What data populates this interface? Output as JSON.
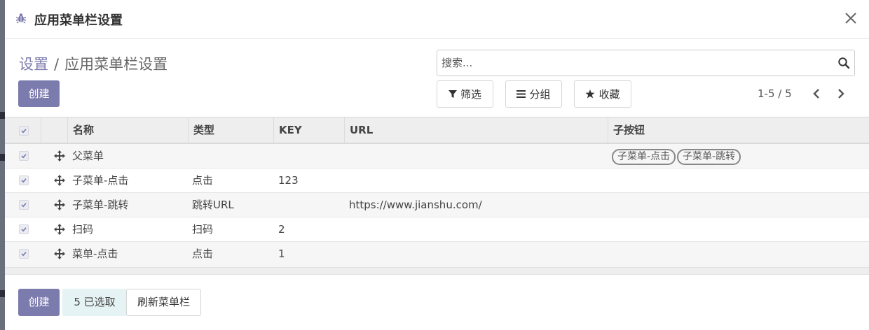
{
  "dialog": {
    "title": "应用菜单栏设置",
    "close_label": "×"
  },
  "breadcrumb": {
    "parent": "设置",
    "separator": "/",
    "current": "应用菜单栏设置"
  },
  "toolbar": {
    "create_label": "创建",
    "search_placeholder": "搜索...",
    "filter_label": "筛选",
    "group_label": "分组",
    "favorite_label": "收藏",
    "pager_text": "1-5 / 5"
  },
  "table": {
    "columns": [
      "名称",
      "类型",
      "KEY",
      "URL",
      "子按钮"
    ],
    "rows": [
      {
        "name": "父菜单",
        "type": "",
        "key": "",
        "url": "",
        "children": [
          "子菜单-点击",
          "子菜单-跳转"
        ],
        "selected": true
      },
      {
        "name": "子菜单-点击",
        "type": "点击",
        "key": "123",
        "url": "",
        "children": [],
        "selected": true
      },
      {
        "name": "子菜单-跳转",
        "type": "跳转URL",
        "key": "",
        "url": "https://www.jianshu.com/",
        "children": [],
        "selected": true
      },
      {
        "name": "扫码",
        "type": "扫码",
        "key": "2",
        "url": "",
        "children": [],
        "selected": true
      },
      {
        "name": "菜单-点击",
        "type": "点击",
        "key": "1",
        "url": "",
        "children": [],
        "selected": true
      }
    ]
  },
  "footer": {
    "create_label": "创建",
    "selected_text": "5 已选取",
    "refresh_label": "刷新菜单栏"
  },
  "colors": {
    "primary": "#7c7bad",
    "selected_badge_bg": "#e6f3f4"
  }
}
